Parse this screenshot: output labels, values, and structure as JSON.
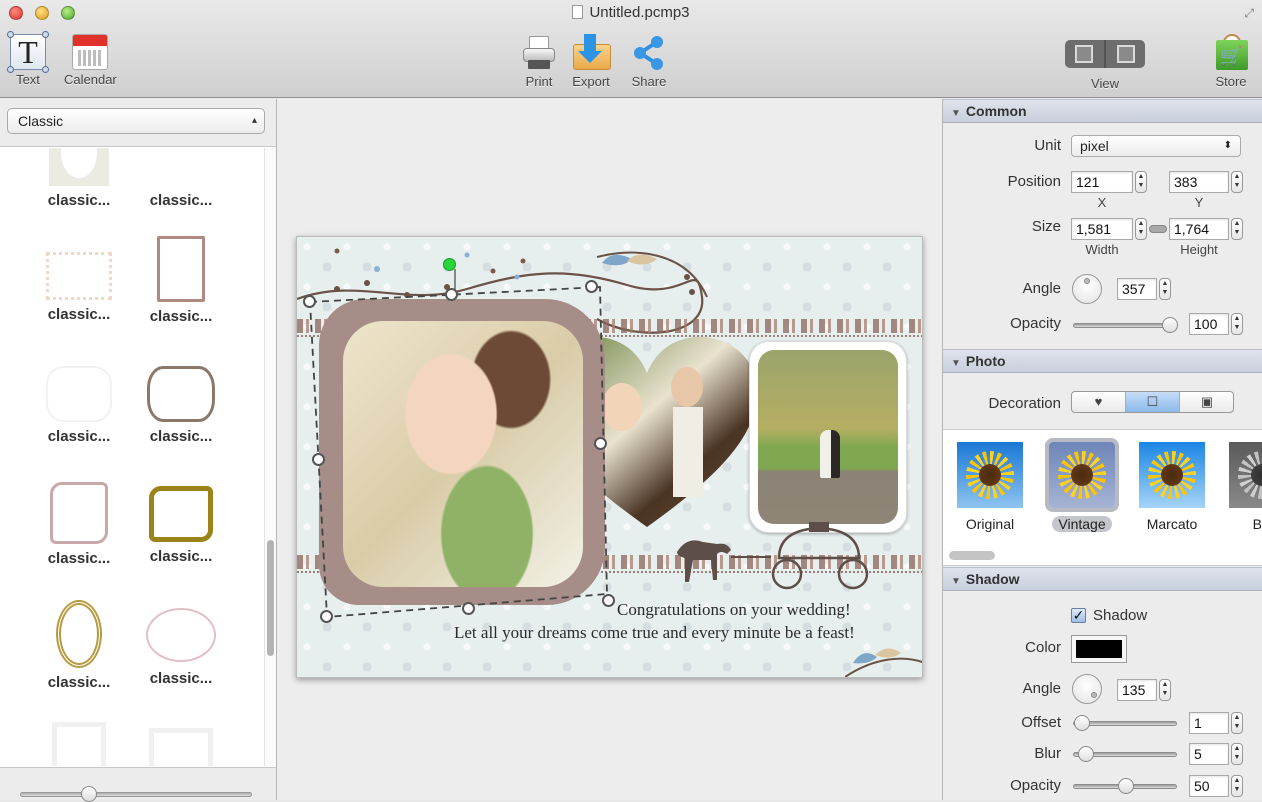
{
  "window": {
    "title": "Untitled.pcmp3"
  },
  "toolbar": {
    "text_label": "Text",
    "calendar_label": "Calendar",
    "print_label": "Print",
    "export_label": "Export",
    "share_label": "Share",
    "view_label": "View",
    "store_label": "Store"
  },
  "left_panel": {
    "category": "Classic",
    "items": [
      {
        "label": "classic...",
        "icon": "oval-frame-cream"
      },
      {
        "label": "classic...",
        "icon": "blank-frame"
      },
      {
        "label": "classic...",
        "icon": "dotted-rect-frame"
      },
      {
        "label": "classic...",
        "icon": "brown-rect-frame"
      },
      {
        "label": "classic...",
        "icon": "white-rounded-frame"
      },
      {
        "label": "classic...",
        "icon": "brown-barrel-frame"
      },
      {
        "label": "classic...",
        "icon": "pink-scalloped-frame"
      },
      {
        "label": "classic...",
        "icon": "gold-scalloped-frame"
      },
      {
        "label": "classic...",
        "icon": "gold-ornate-oval-frame"
      },
      {
        "label": "classic...",
        "icon": "pink-oval-frame"
      },
      {
        "label": "",
        "icon": "white-square-frame"
      },
      {
        "label": "",
        "icon": "white-square-frame"
      }
    ],
    "thumbnail_zoom": 0.3
  },
  "canvas": {
    "greeting_line1": "Congratulations on your wedding!",
    "greeting_line2": "Let all your dreams come true and every minute be a feast!"
  },
  "inspector": {
    "common": {
      "header": "Common",
      "unit_label": "Unit",
      "unit_value": "pixel",
      "position_label": "Position",
      "x_value": "121",
      "y_value": "383",
      "x_label": "X",
      "y_label": "Y",
      "size_label": "Size",
      "width_value": "1,581",
      "height_value": "1,764",
      "width_label": "Width",
      "height_label": "Height",
      "angle_label": "Angle",
      "angle_value": "357",
      "opacity_label": "Opacity",
      "opacity_value": "100"
    },
    "photo": {
      "header": "Photo",
      "decoration_label": "Decoration",
      "decoration_options": [
        "heart",
        "frame",
        "picture"
      ],
      "decoration_selected": "frame",
      "filters": [
        {
          "label": "Original",
          "selected": false
        },
        {
          "label": "Vintage",
          "selected": true
        },
        {
          "label": "Marcato",
          "selected": false
        },
        {
          "label": "B&",
          "selected": false
        }
      ]
    },
    "shadow": {
      "header": "Shadow",
      "enabled_label": "Shadow",
      "enabled": true,
      "color_label": "Color",
      "color_value": "#000000",
      "angle_label": "Angle",
      "angle_value": "135",
      "offset_label": "Offset",
      "offset_value": "1",
      "blur_label": "Blur",
      "blur_value": "5",
      "opacity_label": "Opacity",
      "opacity_value": "50"
    }
  }
}
